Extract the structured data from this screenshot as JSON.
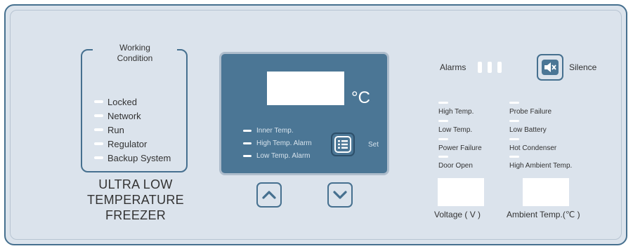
{
  "working_condition": {
    "title_line1": "Working",
    "title_line2": "Condition",
    "items": [
      {
        "label": "Locked"
      },
      {
        "label": "Network"
      },
      {
        "label": "Run"
      },
      {
        "label": "Regulator"
      },
      {
        "label": "Backup System"
      }
    ]
  },
  "brand": {
    "line1": "ULTRA LOW",
    "line2": "TEMPERATURE",
    "line3": "FREEZER"
  },
  "display": {
    "unit": "°C",
    "indicators": [
      {
        "label": "Inner Temp."
      },
      {
        "label": "High Temp. Alarm"
      },
      {
        "label": "Low Temp. Alarm"
      }
    ],
    "set_label": "Set"
  },
  "alarms": {
    "label": "Alarms",
    "silence_label": "Silence",
    "items": [
      {
        "label": "High Temp."
      },
      {
        "label": "Probe Failure"
      },
      {
        "label": "Low Temp."
      },
      {
        "label": "Low Battery"
      },
      {
        "label": "Power Failure"
      },
      {
        "label": "Hot Condenser"
      },
      {
        "label": "Door Open"
      },
      {
        "label": "High Ambient Temp."
      }
    ]
  },
  "meters": {
    "voltage_label": "Voltage ( V )",
    "ambient_label": "Ambient Temp.(℃ )"
  },
  "colors": {
    "panel": "#dbe3ec",
    "border": "#46708f",
    "display": "#4b7695",
    "led_off": "#ffffff"
  },
  "icons": [
    "set-menu-icon",
    "up-arrow-icon",
    "down-arrow-icon",
    "speaker-mute-icon"
  ]
}
